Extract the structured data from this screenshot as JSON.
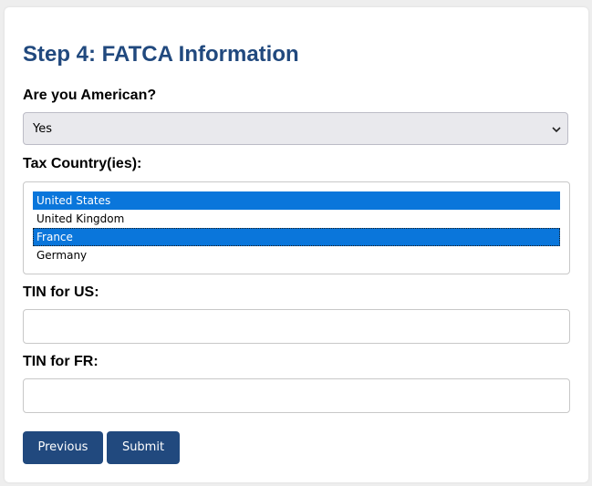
{
  "form": {
    "title": "Step 4: FATCA Information",
    "american_question": {
      "label": "Are you American?",
      "selected_value": "Yes"
    },
    "tax_countries": {
      "label": "Tax Country(ies):",
      "options": [
        {
          "label": "United States",
          "selected": true
        },
        {
          "label": "United Kingdom",
          "selected": false
        },
        {
          "label": "France",
          "selected": true
        },
        {
          "label": "Germany",
          "selected": false
        }
      ]
    },
    "tin_us": {
      "label": "TIN for US:",
      "value": ""
    },
    "tin_fr": {
      "label": "TIN for FR:",
      "value": ""
    },
    "buttons": {
      "previous": "Previous",
      "submit": "Submit"
    }
  },
  "colors": {
    "title": "#21497e",
    "button_bg": "#21497e",
    "selected_option": "#0a76db",
    "select_bg": "#e9e9ed"
  },
  "icons": {
    "select_arrow": "chevron-down-icon"
  }
}
